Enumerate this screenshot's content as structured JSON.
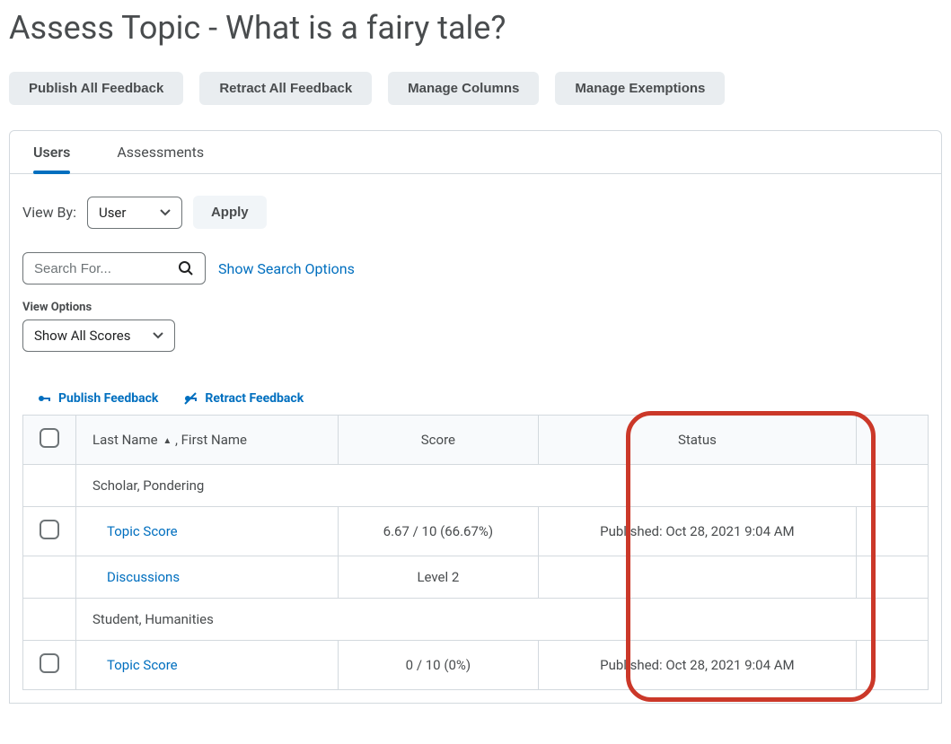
{
  "page_title": "Assess Topic - What is a fairy tale?",
  "action_buttons": [
    "Publish All Feedback",
    "Retract All Feedback",
    "Manage Columns",
    "Manage Exemptions"
  ],
  "tabs": [
    {
      "label": "Users",
      "active": true
    },
    {
      "label": "Assessments",
      "active": false
    }
  ],
  "view_by": {
    "label": "View By:",
    "selected": "User",
    "apply": "Apply"
  },
  "search": {
    "placeholder": "Search For...",
    "show_options": "Show Search Options"
  },
  "view_options": {
    "label": "View Options",
    "selected": "Show All Scores"
  },
  "feedback_links": {
    "publish": "Publish Feedback",
    "retract": "Retract Feedback"
  },
  "columns": {
    "name": "Last Name",
    "name_suffix": ", First Name",
    "score": "Score",
    "status": "Status"
  },
  "rows": [
    {
      "type": "user",
      "name": "Scholar, Pondering"
    },
    {
      "type": "score",
      "label": "Topic Score",
      "score": "6.67 / 10 (66.67%)",
      "status": "Published: Oct 28, 2021 9:04 AM",
      "checkbox": true
    },
    {
      "type": "score",
      "label": "Discussions",
      "score": "Level 2",
      "status": "",
      "checkbox": false
    },
    {
      "type": "user",
      "name": "Student, Humanities"
    },
    {
      "type": "score",
      "label": "Topic Score",
      "score": "0 / 10 (0%)",
      "status": "Published: Oct 28, 2021 9:04 AM",
      "checkbox": true
    }
  ],
  "colors": {
    "link": "#006fbf",
    "highlight": "#cb3829"
  }
}
